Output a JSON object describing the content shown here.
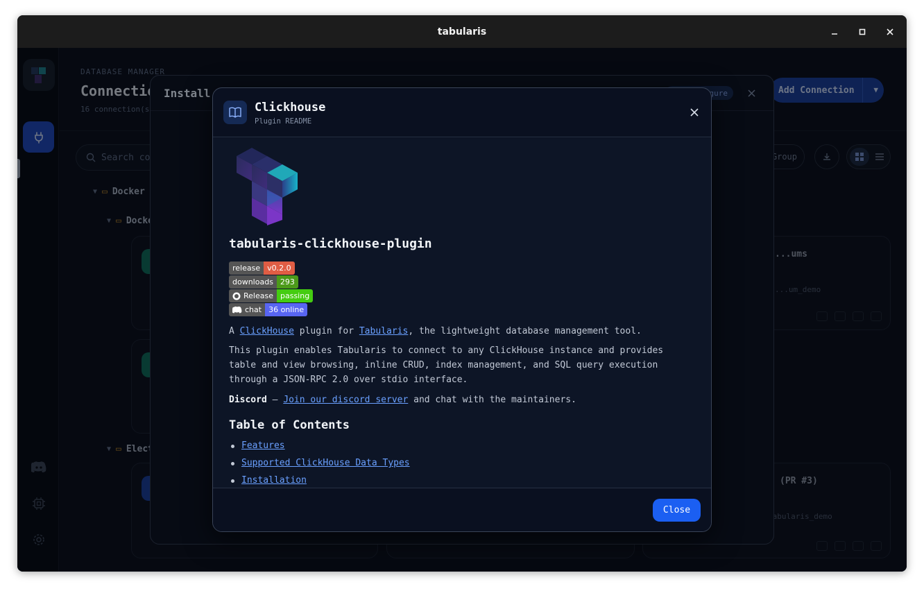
{
  "window": {
    "title": "tabularis"
  },
  "header": {
    "section": "DATABASE MANAGER",
    "title": "Connections",
    "subtitle": "16 connection(s)",
    "add_button": "Add Connection"
  },
  "toolbar": {
    "search_placeholder": "Search connections...",
    "group_label": "Group"
  },
  "tree": {
    "groups": [
      {
        "label": "Docker"
      },
      {
        "label": "Docker"
      },
      {
        "label": "Electron"
      }
    ]
  },
  "cards": [
    {
      "title": "...ums",
      "sub": "...um_demo"
    },
    {
      "title": "(PR #3)",
      "sub": "tabularis_demo"
    }
  ],
  "install_modal": {
    "title": "Install",
    "badge": "Configure"
  },
  "readme": {
    "title": "Clickhouse",
    "subtitle": "Plugin README",
    "heading": "tabularis-clickhouse-plugin",
    "badges": [
      {
        "label": "release",
        "value": "v0.2.0",
        "color": "#e05d44"
      },
      {
        "label": "downloads",
        "value": "293",
        "color": "#4c9a1a"
      },
      {
        "label": "Release",
        "value": "passing",
        "color": "#44cc11"
      },
      {
        "label": "chat",
        "value": "36 online",
        "color": "#5865f2"
      }
    ],
    "intro": {
      "a": "A ",
      "link1": "ClickHouse",
      "b": " plugin for ",
      "link2": "Tabularis",
      "c": ", the lightweight database management tool."
    },
    "description": "This plugin enables Tabularis to connect to any ClickHouse instance and provides table and view browsing, inline CRUD, index management, and SQL query execution through a JSON-RPC 2.0 over stdio interface.",
    "discord": {
      "label": "Discord",
      "dash": " – ",
      "link": "Join our discord server",
      "rest": " and chat with the maintainers."
    },
    "toc_title": "Table of Contents",
    "toc": [
      "Features",
      "Supported ClickHouse Data Types",
      "Installation"
    ],
    "close_button": "Close"
  },
  "colors": {
    "accent": "#1b5ff2",
    "link": "#6aa0ff"
  }
}
